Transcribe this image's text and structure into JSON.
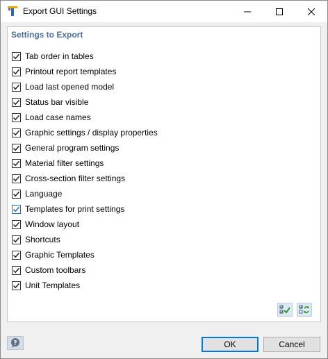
{
  "window": {
    "title": "Export GUI Settings"
  },
  "group": {
    "title": "Settings to Export",
    "items": [
      {
        "label": "Tab order in tables",
        "checked": true
      },
      {
        "label": "Printout report templates",
        "checked": true
      },
      {
        "label": "Load last opened model",
        "checked": true
      },
      {
        "label": "Status bar visible",
        "checked": true
      },
      {
        "label": "Load case names",
        "checked": true
      },
      {
        "label": "Graphic settings / display properties",
        "checked": true
      },
      {
        "label": "General program settings",
        "checked": true
      },
      {
        "label": "Material filter settings",
        "checked": true
      },
      {
        "label": "Cross-section filter settings",
        "checked": true
      },
      {
        "label": "Language",
        "checked": true
      },
      {
        "label": "Templates for print settings",
        "checked": true
      },
      {
        "label": "Window layout",
        "checked": true
      },
      {
        "label": "Shortcuts",
        "checked": true
      },
      {
        "label": "Graphic Templates",
        "checked": true
      },
      {
        "label": "Custom toolbars",
        "checked": true
      },
      {
        "label": "Unit Templates",
        "checked": true
      }
    ]
  },
  "footer": {
    "ok_label": "OK",
    "cancel_label": "Cancel"
  },
  "colors": {
    "group_title": "#4a6f9c",
    "default_button_border": "#0078d7",
    "highlight_checkbox_border": "#1a73c9"
  }
}
